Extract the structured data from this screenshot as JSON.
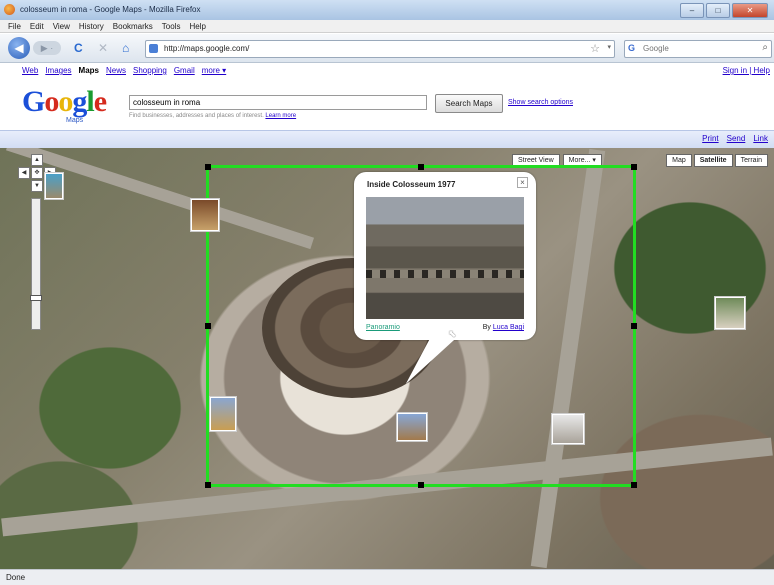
{
  "window": {
    "title": "colosseum in roma - Google Maps - Mozilla Firefox",
    "minimize": "–",
    "maximize": "□",
    "close": "✕"
  },
  "menu": [
    "File",
    "Edit",
    "View",
    "History",
    "Bookmarks",
    "Tools",
    "Help"
  ],
  "nav": {
    "back": "◀",
    "forward": "▶ ·",
    "reload": "C",
    "stop": "✕",
    "home": "⌂",
    "url": "http://maps.google.com/",
    "bookmark_star": "☆",
    "search_engine": "G",
    "search_placeholder": "Google",
    "search_icon": "⌕"
  },
  "gbar": {
    "links": [
      "Web",
      "Images",
      "Maps",
      "News",
      "Shopping",
      "Gmail",
      "more ▾"
    ],
    "current": "Maps",
    "signin": "Sign in | Help"
  },
  "search": {
    "logo": {
      "g1": "G",
      "o1": "o",
      "o2": "o",
      "g2": "g",
      "l": "l",
      "e": "e",
      "sub": "Maps"
    },
    "query": "colosseum in roma",
    "hint": "Find businesses, addresses and places of interest.",
    "hint_link": "Learn more",
    "button": "Search Maps",
    "options": "Show search options"
  },
  "linkbar": [
    "Print",
    "Send",
    "Link"
  ],
  "map": {
    "type_buttons": [
      "Map",
      "Satellite",
      "Terrain"
    ],
    "selected_type": "Satellite",
    "extra_buttons": [
      "Street View",
      "More... ▾"
    ],
    "pan": {
      "up": "▲",
      "left": "◀",
      "right": "▶",
      "down": "▼",
      "center": "✥"
    },
    "zoom_in": "+",
    "zoom_out": "–"
  },
  "bubble": {
    "title": "Inside Colosseum 1977",
    "close": "×",
    "source": "Panoramio",
    "by_prefix": "By ",
    "author": "Luca Bagi"
  },
  "status": "Done"
}
